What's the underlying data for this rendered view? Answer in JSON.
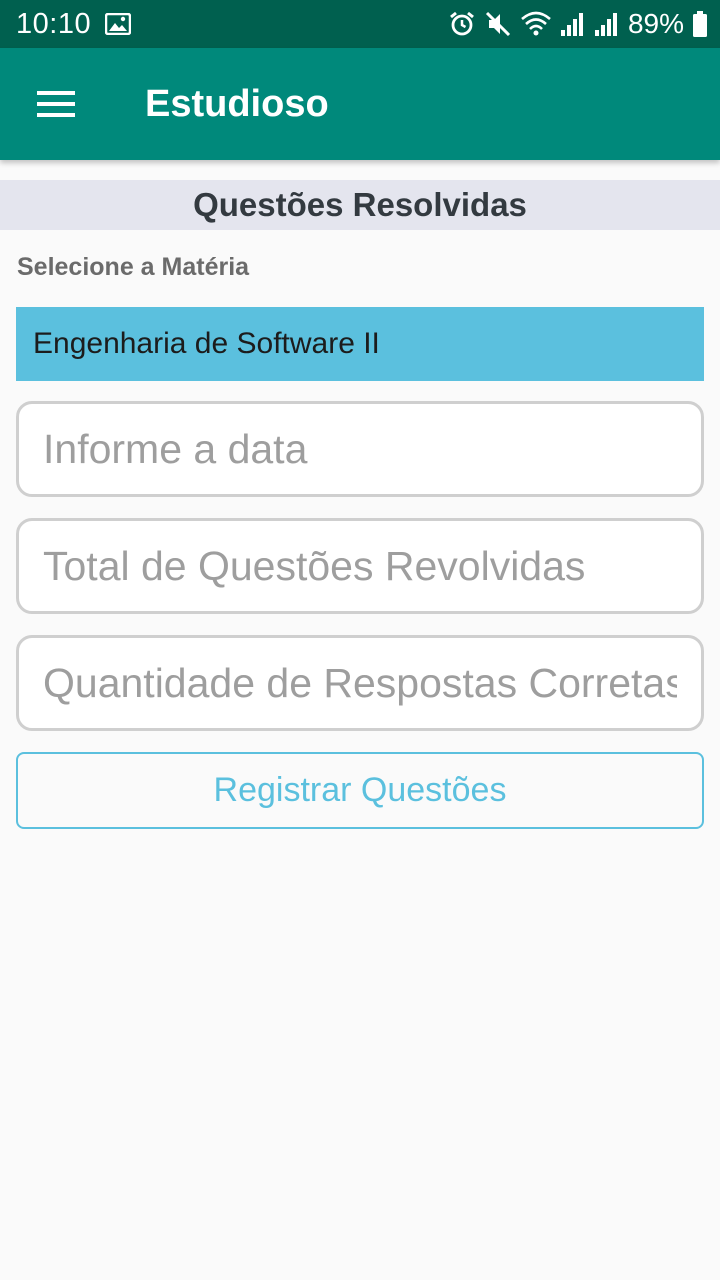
{
  "status_bar": {
    "time": "10:10",
    "battery_percent": "89%",
    "icons": [
      "gallery-icon",
      "alarm-icon",
      "mute-icon",
      "wifi-icon",
      "signal-icon",
      "signal-icon",
      "battery-icon"
    ]
  },
  "app_bar": {
    "title": "Estudioso",
    "menu_icon": "hamburger-menu-icon"
  },
  "page": {
    "section_title": "Questões Resolvidas",
    "subject_label": "Selecione a Matéria",
    "subject_selected": "Engenharia de Software II",
    "date_placeholder": "Informe a data",
    "total_placeholder": "Total de Questões Revolvidas",
    "correct_placeholder": "Quantidade de Respostas Corretas",
    "register_button": "Registrar Questões"
  },
  "colors": {
    "status_bar": "#00604f",
    "app_bar": "#00897b",
    "section_bg": "#e4e5ee",
    "select_bg": "#5bc0de",
    "button_accent": "#5bc0de"
  }
}
